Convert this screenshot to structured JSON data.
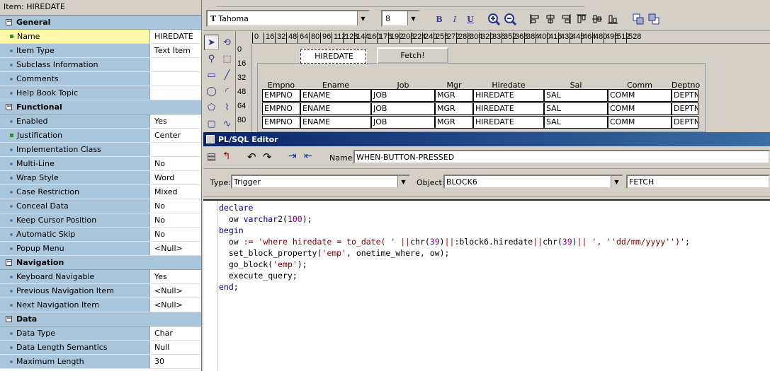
{
  "palette": {
    "title": "Item: HIREDATE",
    "categories": [
      {
        "name": "General",
        "props": [
          {
            "name": "Name",
            "value": "HIREDATE",
            "selected": true
          },
          {
            "name": "Item Type",
            "value": "Text Item"
          },
          {
            "name": "Subclass Information",
            "value": ""
          },
          {
            "name": "Comments",
            "value": ""
          },
          {
            "name": "Help Book Topic",
            "value": ""
          }
        ]
      },
      {
        "name": "Functional",
        "props": [
          {
            "name": "Enabled",
            "value": "Yes"
          },
          {
            "name": "Justification",
            "value": "Center",
            "changed": true
          },
          {
            "name": "Implementation Class",
            "value": ""
          },
          {
            "name": "Multi-Line",
            "value": "No"
          },
          {
            "name": "Wrap Style",
            "value": "Word"
          },
          {
            "name": "Case Restriction",
            "value": "Mixed"
          },
          {
            "name": "Conceal Data",
            "value": "No"
          },
          {
            "name": "Keep Cursor Position",
            "value": "No"
          },
          {
            "name": "Automatic Skip",
            "value": "No"
          },
          {
            "name": "Popup Menu",
            "value": "<Null>"
          }
        ]
      },
      {
        "name": "Navigation",
        "props": [
          {
            "name": "Keyboard Navigable",
            "value": "Yes"
          },
          {
            "name": "Previous Navigation Item",
            "value": "<Null>"
          },
          {
            "name": "Next Navigation Item",
            "value": "<Null>"
          }
        ]
      },
      {
        "name": "Data",
        "props": [
          {
            "name": "Data Type",
            "value": "Char"
          },
          {
            "name": "Data Length Semantics",
            "value": "Null"
          },
          {
            "name": "Maximum Length",
            "value": "30"
          }
        ]
      }
    ]
  },
  "toolbar": {
    "font": "Tahoma",
    "size": "8",
    "bold": "B",
    "italic": "I",
    "underline": "U"
  },
  "ruler_h": [
    "0",
    "16",
    "32",
    "48",
    "64",
    "80",
    "96",
    "112",
    "128",
    "144",
    "160",
    "176",
    "192",
    "208",
    "224",
    "240",
    "256",
    "272",
    "288",
    "304",
    "320",
    "336",
    "352",
    "368",
    "384",
    "400",
    "416",
    "432",
    "448",
    "464",
    "480",
    "496",
    "512",
    "528"
  ],
  "ruler_v": [
    "0",
    "16",
    "32",
    "48",
    "64",
    "80"
  ],
  "layout": {
    "hiredate_item": "HIREDATE",
    "fetch_button": "Fetch!",
    "columns": [
      "Empno",
      "Ename",
      "Job",
      "Mgr",
      "Hiredate",
      "Sal",
      "Comm",
      "Deptno"
    ],
    "row_values": [
      "EMPNO",
      "ENAME",
      "JOB",
      "MGR",
      "HIREDATE",
      "SAL",
      "COMM",
      "DEPTN"
    ]
  },
  "editor": {
    "title": "PL/SQL Editor",
    "name_label": "Name:",
    "name_value": "WHEN-BUTTON-PRESSED",
    "type_label": "Type:",
    "type_value": "Trigger",
    "object_label": "Object:",
    "object_value": "BLOCK6",
    "object2_value": "FETCH",
    "code": [
      "declare",
      "  ow varchar2(100);",
      "begin",
      "  ow := 'where hiredate = to_date( ' ||chr(39)||:block6.hiredate||chr(39)|| ', ''dd/mm/yyyy'')';",
      "  set_block_property('emp', onetime_where, ow);",
      "  go_block('emp');",
      "  execute_query;",
      "end;"
    ]
  }
}
